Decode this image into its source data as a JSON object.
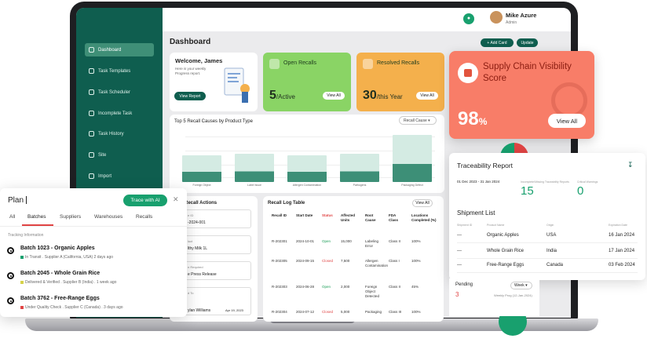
{
  "app": {
    "user": {
      "name": "Mike Azure",
      "role": "Admin"
    },
    "page_title": "Dashboard",
    "actions": {
      "add_card": "+ Add Card",
      "update": "Update"
    }
  },
  "sidebar": {
    "items": [
      {
        "label": "Dashboard",
        "icon": "dashboard-icon",
        "active": true
      },
      {
        "label": "Task Templates",
        "icon": "template-icon"
      },
      {
        "label": "Task Scheduler",
        "icon": "scheduler-icon"
      },
      {
        "label": "Incomplete Task",
        "icon": "incomplete-icon"
      },
      {
        "label": "Task History",
        "icon": "history-icon"
      },
      {
        "label": "Site",
        "icon": "site-icon"
      },
      {
        "label": "Import",
        "icon": "import-icon"
      }
    ]
  },
  "welcome": {
    "title": "Welcome, James",
    "text": "Here is your weekly Progress report.",
    "button": "View Report"
  },
  "open_recalls": {
    "label": "Open Recalls",
    "value": "5",
    "suffix": "/Active",
    "button": "View All",
    "color": "#8ad465"
  },
  "resolved_recalls": {
    "label": "Resolved Recalls",
    "value": "30",
    "suffix": "/this Year",
    "button": "View All",
    "color": "#f4b04c"
  },
  "recall_causes": {
    "title": "Top 5 Recall Causes by Product Type",
    "dropdown": "Recall Cause",
    "categories": [
      "Foreign Object",
      "Label Issue",
      "Allergen Contamination",
      "Pathogens",
      "Packaging Defect"
    ]
  },
  "chart_data": {
    "type": "bar",
    "categories": [
      "Foreign Object",
      "Label Issue",
      "Allergen Contamination",
      "Pathogens",
      "Packaging Defect"
    ],
    "values": [
      0.3,
      0.35,
      0.3,
      0.35,
      0.7
    ],
    "title": "Top 5 Recall Causes by Product Type"
  },
  "recall_actions": {
    "title": "ng Recall Actions",
    "rows": [
      {
        "label": "e ID",
        "value": "-2024-001"
      },
      {
        "label": "luct",
        "value": "lthy Milk 1L"
      },
      {
        "label": "n Required",
        "value": "e Press Release"
      },
      {
        "label": "d To",
        "value": "ylan Williams",
        "date": "Apr 19, 2023"
      }
    ]
  },
  "recall_log": {
    "title": "Recall Log Table",
    "button": "View All",
    "headers": [
      "Recall ID",
      "Start Date",
      "Status",
      "Affected Units",
      "Root Cause",
      "FDA Class",
      "Locations Completed (%)"
    ],
    "rows": [
      [
        "R-202301",
        "2024-10-01",
        "Open",
        "15,000",
        "Labeling Error",
        "Class II",
        "100%"
      ],
      [
        "R-202305",
        "2024-09-15",
        "Closed",
        "7,500",
        "Allergen Contamination",
        "Class I",
        "100%"
      ],
      [
        "R-202303",
        "2024-06-28",
        "Open",
        "2,000",
        "Foreign Object Detected",
        "Class II",
        "45%"
      ],
      [
        "R-202304",
        "2024-07-12",
        "Closed",
        "5,000",
        "Packaging",
        "Class III",
        "100%"
      ]
    ]
  },
  "supply_chain": {
    "title": "Supply Chain Visibility Score",
    "score": "98",
    "unit": "%",
    "button": "View All",
    "color": "#f87d68"
  },
  "traceability": {
    "title": "Traceability Report",
    "date_range": "01 Dec 2023 - 31 Jan 2024",
    "kpis": [
      {
        "label": "Incomplete/Missing Traceability Reports",
        "value": "15"
      },
      {
        "label": "Critical Warnings",
        "value": "0"
      }
    ],
    "shipment_title": "Shipment List",
    "headers": [
      "Shipment ID",
      "Product Name",
      "Origin",
      "Expiration Date"
    ],
    "rows": [
      [
        "---",
        "Organic Apples",
        "USA",
        "16 Jan 2024"
      ],
      [
        "---",
        "Whole Grain Rice",
        "India",
        "17 Jan 2024"
      ],
      [
        "---",
        "Free-Range Eggs",
        "Canada",
        "03 Feb 2024"
      ]
    ]
  },
  "pending": {
    "title": "Pending",
    "value": "3",
    "sub": "Weekly Prog (12-Jan-2024)",
    "dropdown": "Week"
  },
  "search": {
    "query": "Plan",
    "trace_ai": "Trace with AI",
    "tabs": [
      "All",
      "Batches",
      "Suppliers",
      "Warehouses",
      "Recalls"
    ],
    "active_tab": "Batches",
    "section_label": "Tracking Information",
    "items": [
      {
        "title": "Batch 1023 - Organic Apples",
        "sub": "In Transit . Supplier A (California, USA) 2 days ago",
        "dot_color": "#18a06e"
      },
      {
        "title": "Batch 2045 - Whole Grain Rice",
        "sub": "Delivered & Verified . Supplier B (India) . 1 week ago",
        "dot_color": "#d6d24a"
      },
      {
        "title": "Batch 3762 - Free-Range Eggs",
        "sub": "Under Quality Check . Supplier C (Canada) . 3 days ago",
        "dot_color": "#e04444"
      }
    ]
  }
}
